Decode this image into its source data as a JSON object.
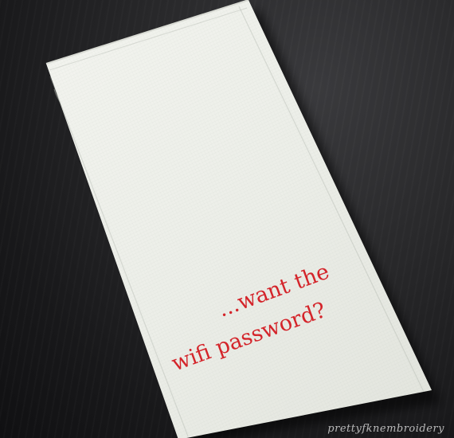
{
  "photo": {
    "description_colors": {
      "table": "#1c1c1e",
      "towel": "#eef0ea",
      "embroidery": "#d4242a"
    }
  },
  "embroidery": {
    "line1": "...want the",
    "line2": "wifi password?"
  },
  "watermark": {
    "text": "prettyfknembroidery"
  }
}
